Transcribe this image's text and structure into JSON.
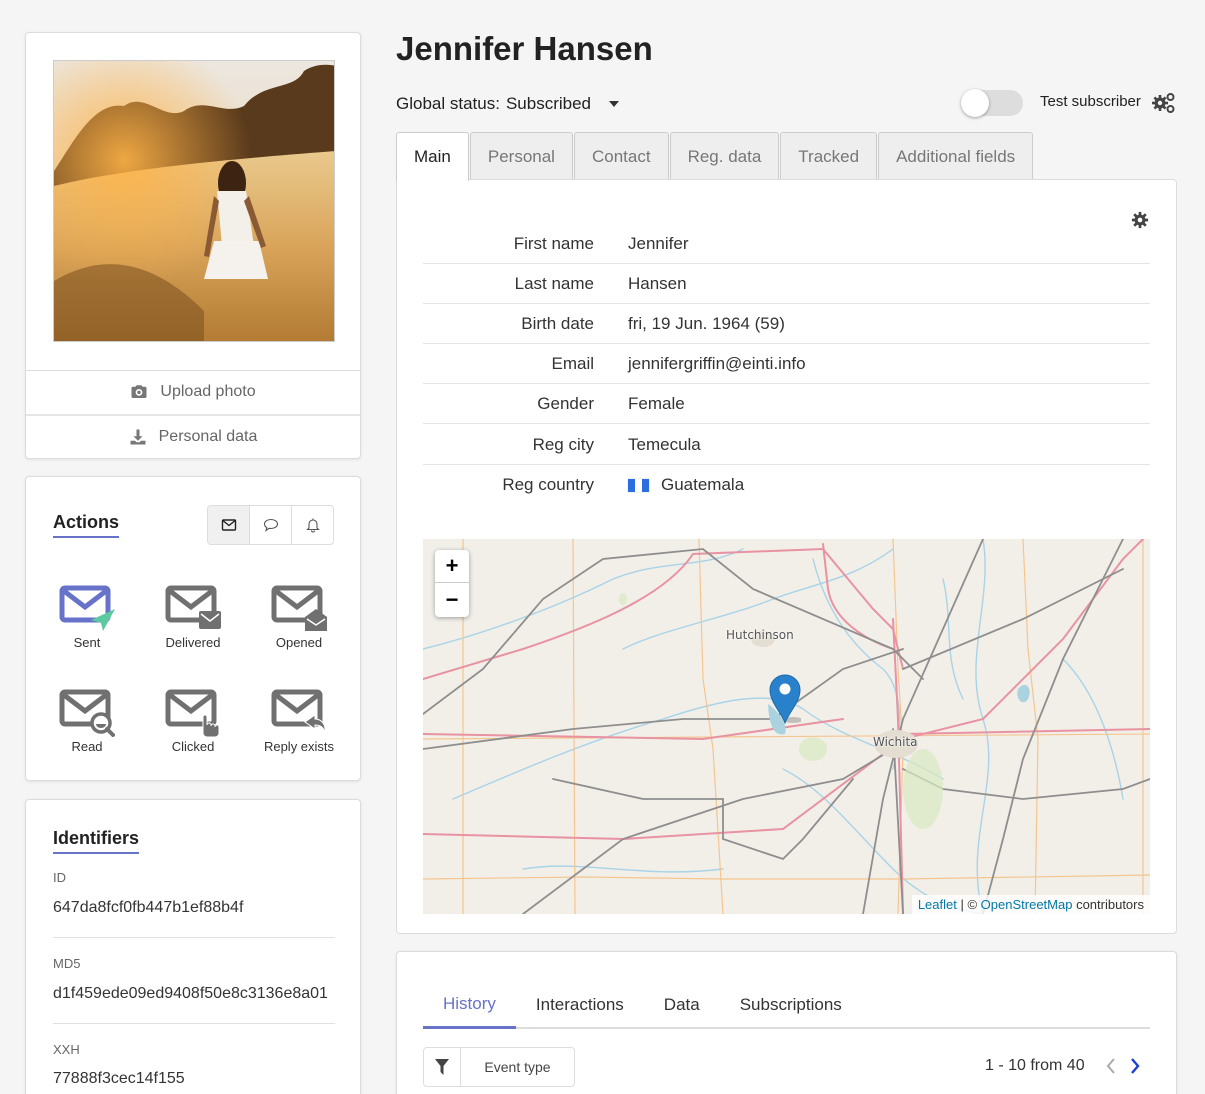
{
  "profile": {
    "name": "Jennifer Hansen",
    "photo_alt": "Woman in white dress walking through a golden wheat field",
    "upload_photo_label": "Upload photo",
    "personal_data_label": "Personal data"
  },
  "header": {
    "global_status_label": "Global status:",
    "global_status_value": "Subscribed",
    "test_subscriber_label": "Test subscriber",
    "test_subscriber_enabled": false
  },
  "tabs": [
    {
      "label": "Main",
      "active": true
    },
    {
      "label": "Personal",
      "active": false
    },
    {
      "label": "Contact",
      "active": false
    },
    {
      "label": "Reg. data",
      "active": false
    },
    {
      "label": "Tracked",
      "active": false
    },
    {
      "label": "Additional fields",
      "active": false
    }
  ],
  "main_fields": [
    {
      "label": "First name",
      "value": "Jennifer"
    },
    {
      "label": "Last name",
      "value": "Hansen"
    },
    {
      "label": "Birth date",
      "value": "fri, 19 Jun. 1964 (59)"
    },
    {
      "label": "Email",
      "value": "jennifergriffin@einti.info"
    },
    {
      "label": "Gender",
      "value": "Female"
    },
    {
      "label": "Reg city",
      "value": "Temecula"
    },
    {
      "label": "Reg country",
      "value": "Guatemala",
      "flag": "guatemala-flag"
    }
  ],
  "map": {
    "zoom_in": "+",
    "zoom_out": "−",
    "labels": [
      "Hutchinson",
      "Wichita"
    ],
    "attribution": {
      "leaflet": "Leaflet",
      "separator": " | © ",
      "osm": "OpenStreetMap",
      "suffix": " contributors"
    }
  },
  "actions": {
    "title": "Actions",
    "channels": [
      {
        "icon": "envelope-icon",
        "active": true
      },
      {
        "icon": "chat-bubble-icon",
        "active": false
      },
      {
        "icon": "bell-icon",
        "active": false
      }
    ],
    "items": [
      {
        "label": "Sent",
        "icon": "sent-envelope-icon",
        "active": true
      },
      {
        "label": "Delivered",
        "icon": "delivered-envelope-icon",
        "active": false
      },
      {
        "label": "Opened",
        "icon": "opened-envelope-icon",
        "active": false
      },
      {
        "label": "Read",
        "icon": "read-envelope-icon",
        "active": false
      },
      {
        "label": "Clicked",
        "icon": "clicked-envelope-icon",
        "active": false
      },
      {
        "label": "Reply exists",
        "icon": "reply-envelope-icon",
        "active": false
      }
    ]
  },
  "identifiers": {
    "title": "Identifiers",
    "items": [
      {
        "label": "ID",
        "value": "647da8fcf0fb447b1ef88b4f"
      },
      {
        "label": "MD5",
        "value": "d1f459ede09ed9408f50e8c3136e8a01"
      },
      {
        "label": "XXH",
        "value": "77888f3cec14f155"
      }
    ]
  },
  "history": {
    "tabs": [
      {
        "label": "History",
        "active": true
      },
      {
        "label": "Interactions",
        "active": false
      },
      {
        "label": "Data",
        "active": false
      },
      {
        "label": "Subscriptions",
        "active": false
      }
    ],
    "filter_label": "Event type",
    "pagination": "1 - 10 from 40"
  },
  "colors": {
    "accent": "#6673c9",
    "sent_green": "#5dc9a0",
    "icon_gray": "#707070",
    "page_bg": "#f5f5f5",
    "map_link": "#0078a8",
    "marker_blue": "#2a81cb"
  }
}
